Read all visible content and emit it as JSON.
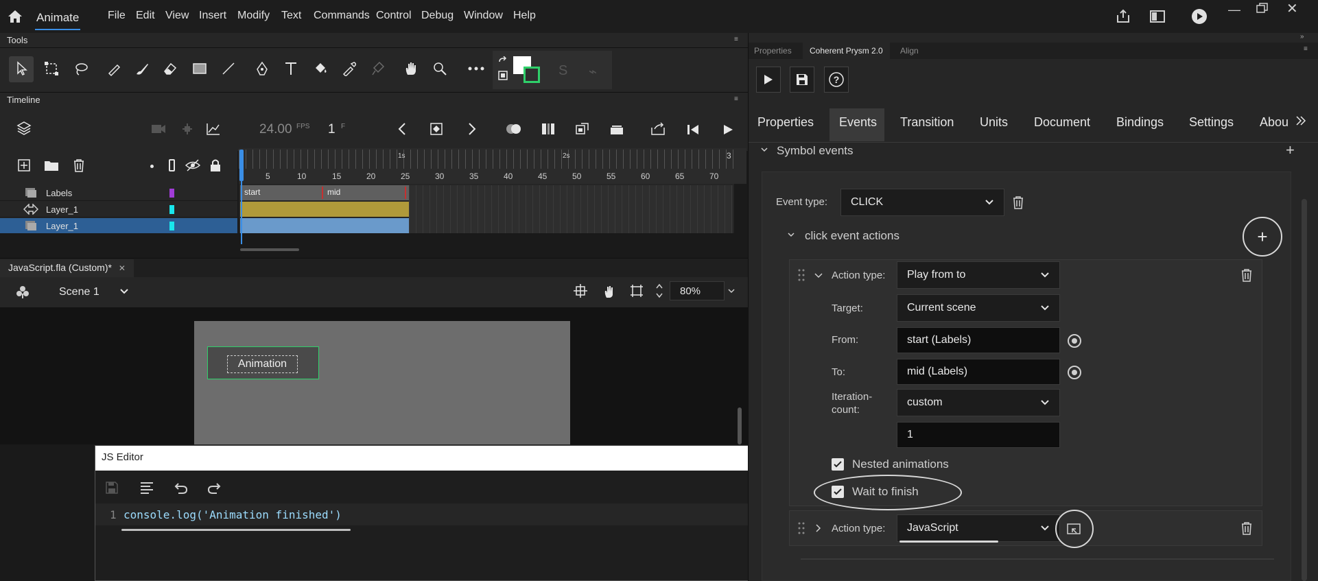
{
  "menubar": {
    "app_name": "Animate",
    "items": [
      "File",
      "Edit",
      "View",
      "Insert",
      "Modify",
      "Text",
      "Commands",
      "Control",
      "Debug",
      "Window",
      "Help"
    ]
  },
  "tools": {
    "title": "Tools"
  },
  "timeline": {
    "title": "Timeline",
    "fps": "24.00",
    "fps_label": "FPS",
    "frame": "1",
    "frame_label": "F",
    "ruler_ticks": [
      "5",
      "10",
      "15",
      "20",
      "25",
      "30",
      "35",
      "40",
      "45",
      "50",
      "55",
      "60",
      "65",
      "70"
    ],
    "second_marks": [
      "1s",
      "2s",
      "3"
    ],
    "layers": [
      {
        "name": "Labels",
        "color": "#a03cd6"
      },
      {
        "name": "Layer_1",
        "color": "#19e6ec"
      },
      {
        "name": "Layer_1",
        "color": "#19e6ec"
      }
    ],
    "frame_labels": [
      "start",
      "mid"
    ]
  },
  "document": {
    "tab": "JavaScript.fla (Custom)*",
    "scene": "Scene 1",
    "zoom": "80%",
    "stage_button_text": "Animation"
  },
  "js_editor": {
    "title": "JS Editor",
    "close": "×",
    "line_number": "1",
    "code": "console.log('Animation finished')"
  },
  "right_panel": {
    "tabs": [
      "Properties",
      "Coherent Prysm 2.0",
      "Align"
    ],
    "nav_tabs": [
      "Properties",
      "Events",
      "Transition",
      "Units",
      "Document",
      "Bindings",
      "Settings",
      "Abou"
    ],
    "section_title": "Symbol events",
    "event_type_label": "Event type:",
    "event_type_value": "CLICK",
    "click_actions_title": "click event actions",
    "action1": {
      "action_type_label": "Action type:",
      "action_type_value": "Play from to",
      "target_label": "Target:",
      "target_value": "Current scene",
      "from_label": "From:",
      "from_value": "start (Labels)",
      "to_label": "To:",
      "to_value": "mid (Labels)",
      "iteration_label_1": "Iteration-",
      "iteration_label_2": "count:",
      "iteration_value": "custom",
      "iteration_count": "1",
      "nested_label": "Nested animations",
      "wait_label": "Wait to finish"
    },
    "action2": {
      "action_type_label": "Action type:",
      "action_type_value": "JavaScript"
    }
  }
}
